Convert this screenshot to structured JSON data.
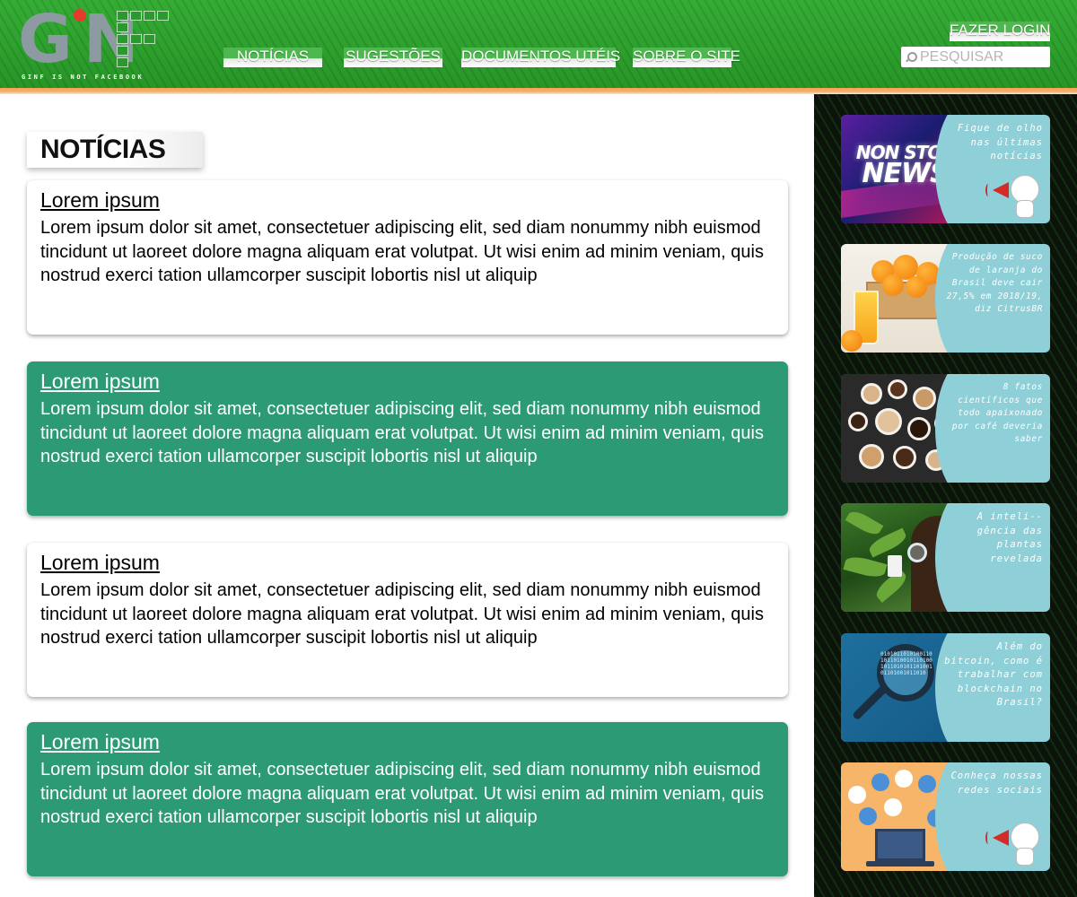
{
  "header": {
    "logo_letters": "GINF",
    "logo_tagline": "GINF IS NOT FACEBOOK",
    "nav": [
      "NOTÍCIAS",
      "SUGESTÕES",
      "DOCUMENTOS UTÉIS",
      "SOBRE O SITE"
    ],
    "login_label": "FAZER LOGIN",
    "search_placeholder": "PESQUISAR"
  },
  "main": {
    "section_title": "NOTÍCIAS",
    "posts": [
      {
        "title": "Lorem ipsum",
        "body": "Lorem ipsum dolor sit amet, consectetuer adipiscing elit, sed diam nonummy nibh euismod tincidunt ut laoreet dolore magna aliquam erat volutpat. Ut wisi enim ad minim veniam, quis nostrud exerci tation ullamcorper suscipit lobortis nisl ut aliquip"
      },
      {
        "title": "Lorem ipsum",
        "body": "Lorem ipsum dolor sit amet, consectetuer adipiscing elit, sed diam nonummy nibh euismod tincidunt ut laoreet dolore magna aliquam erat volutpat. Ut wisi enim ad minim veniam, quis nostrud exerci tation ullamcorper suscipit lobortis nisl ut aliquip"
      },
      {
        "title": "Lorem ipsum",
        "body": "Lorem ipsum dolor sit amet, consectetuer adipiscing elit, sed diam nonummy nibh euismod tincidunt ut laoreet dolore magna aliquam erat volutpat. Ut wisi enim ad minim veniam, quis nostrud exerci tation ullamcorper suscipit lobortis nisl ut aliquip"
      },
      {
        "title": "Lorem ipsum",
        "body": "Lorem ipsum dolor sit amet, consectetuer adipiscing elit, sed diam nonummy nibh euismod tincidunt ut laoreet dolore magna aliquam erat volutpat. Ut wisi enim ad minim veniam, quis nostrud exerci tation ullamcorper suscipit lobortis nisl ut aliquip"
      }
    ]
  },
  "sidebar": {
    "tiles": [
      {
        "image_text_1": "NON STOP",
        "image_text_2": "NEWS",
        "caption": "Fique de olho nas últimas notícias",
        "icon": "megaphone-mascot-icon"
      },
      {
        "caption": "Produção de suco de laranja do Brasil deve cair 27,5% em 2018/19, diz CitrusBR",
        "icon": "orange-juice-image"
      },
      {
        "caption": "8 fatos científicos que todo apaixonado por café deveria saber",
        "icon": "coffee-cups-image"
      },
      {
        "caption": "A inteli--gência das plantas revelada",
        "icon": "plant-scientist-image"
      },
      {
        "image_text": "01010110101001101011010010110100101101010110100101101001011010",
        "caption": "Além do bitcoin, como é trabalhar com blockchain no Brasil?",
        "icon": "magnifier-binary-image"
      },
      {
        "caption": "Conheça nossas redes sociais",
        "icon": "social-network-laptop-image"
      }
    ]
  },
  "colors": {
    "header_green": "#2ea02e",
    "accent_orange": "#f4a24a",
    "card_green": "#2c9a74",
    "sidebar_dark": "#0b130b",
    "tile_teal": "#8fd0d8"
  }
}
